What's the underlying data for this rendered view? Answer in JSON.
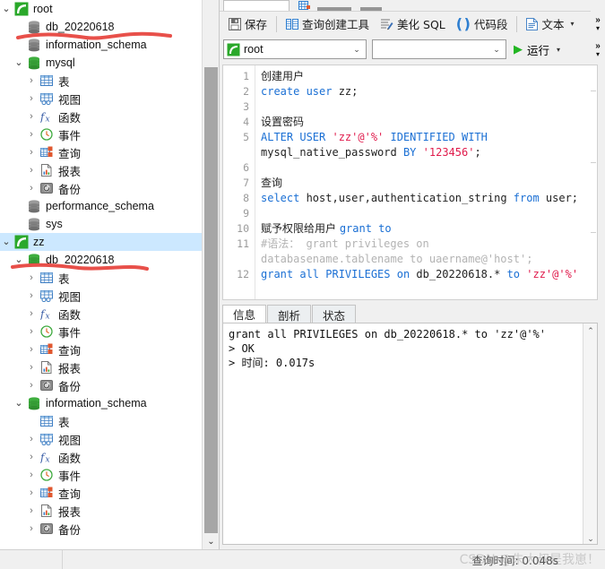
{
  "sidebar": {
    "nodes": [
      {
        "depth": 0,
        "twisty": "open",
        "icon": "connection-icon",
        "label": "root",
        "selected": false
      },
      {
        "depth": 1,
        "twisty": "none",
        "icon": "database-gray-icon",
        "label": "db_20220618",
        "selected": false
      },
      {
        "depth": 1,
        "twisty": "none",
        "icon": "database-gray-icon",
        "label": "information_schema",
        "selected": false
      },
      {
        "depth": 1,
        "twisty": "open",
        "icon": "database-green-icon",
        "label": "mysql",
        "selected": false
      },
      {
        "depth": 2,
        "twisty": "closed",
        "icon": "table-icon",
        "label": "表",
        "selected": false
      },
      {
        "depth": 2,
        "twisty": "closed",
        "icon": "view-icon",
        "label": "视图",
        "selected": false
      },
      {
        "depth": 2,
        "twisty": "closed",
        "icon": "function-icon",
        "label": "函数",
        "selected": false
      },
      {
        "depth": 2,
        "twisty": "closed",
        "icon": "event-icon",
        "label": "事件",
        "selected": false
      },
      {
        "depth": 2,
        "twisty": "closed",
        "icon": "query-icon",
        "label": "查询",
        "selected": false
      },
      {
        "depth": 2,
        "twisty": "closed",
        "icon": "report-icon",
        "label": "报表",
        "selected": false
      },
      {
        "depth": 2,
        "twisty": "closed",
        "icon": "backup-icon",
        "label": "备份",
        "selected": false
      },
      {
        "depth": 1,
        "twisty": "none",
        "icon": "database-gray-icon",
        "label": "performance_schema",
        "selected": false
      },
      {
        "depth": 1,
        "twisty": "none",
        "icon": "database-gray-icon",
        "label": "sys",
        "selected": false
      },
      {
        "depth": 0,
        "twisty": "open",
        "icon": "connection-icon",
        "label": "zz",
        "selected": true
      },
      {
        "depth": 1,
        "twisty": "open",
        "icon": "database-green-icon",
        "label": "db_20220618",
        "selected": false
      },
      {
        "depth": 2,
        "twisty": "closed",
        "icon": "table-icon",
        "label": "表",
        "selected": false
      },
      {
        "depth": 2,
        "twisty": "closed",
        "icon": "view-icon",
        "label": "视图",
        "selected": false
      },
      {
        "depth": 2,
        "twisty": "closed",
        "icon": "function-icon",
        "label": "函数",
        "selected": false
      },
      {
        "depth": 2,
        "twisty": "closed",
        "icon": "event-icon",
        "label": "事件",
        "selected": false
      },
      {
        "depth": 2,
        "twisty": "closed",
        "icon": "query-icon",
        "label": "查询",
        "selected": false
      },
      {
        "depth": 2,
        "twisty": "closed",
        "icon": "report-icon",
        "label": "报表",
        "selected": false
      },
      {
        "depth": 2,
        "twisty": "closed",
        "icon": "backup-icon",
        "label": "备份",
        "selected": false
      },
      {
        "depth": 1,
        "twisty": "open",
        "icon": "database-green-icon",
        "label": "information_schema",
        "selected": false
      },
      {
        "depth": 2,
        "twisty": "none",
        "icon": "table-icon",
        "label": "表",
        "selected": false
      },
      {
        "depth": 2,
        "twisty": "closed",
        "icon": "view-icon",
        "label": "视图",
        "selected": false
      },
      {
        "depth": 2,
        "twisty": "closed",
        "icon": "function-icon",
        "label": "函数",
        "selected": false
      },
      {
        "depth": 2,
        "twisty": "closed",
        "icon": "event-icon",
        "label": "事件",
        "selected": false
      },
      {
        "depth": 2,
        "twisty": "closed",
        "icon": "query-icon",
        "label": "查询",
        "selected": false
      },
      {
        "depth": 2,
        "twisty": "closed",
        "icon": "report-icon",
        "label": "报表",
        "selected": false
      },
      {
        "depth": 2,
        "twisty": "closed",
        "icon": "backup-icon",
        "label": "备份",
        "selected": false
      }
    ],
    "scroll_down_glyph": "⌄"
  },
  "annotations": {
    "color": "#e8504a",
    "marks": [
      {
        "name": "underline-db-20220618-root"
      },
      {
        "name": "underline-db-20220618-zz"
      }
    ]
  },
  "toolbar": {
    "save_label": "保存",
    "save_icon": "save-icon",
    "query_builder_label": "查询创建工具",
    "query_builder_icon": "query-builder-icon",
    "beautify_label": "美化 SQL",
    "beautify_icon": "beautify-icon",
    "snippet_label": "代码段",
    "snippet_icon": "parens-icon",
    "text_label": "文本",
    "text_icon": "text-icon",
    "overflow_glyph": "»",
    "caret_glyph": "▾"
  },
  "connbar": {
    "connection_value": "root",
    "connection_icon": "connection-icon",
    "database_value": "",
    "database_placeholder": "",
    "run_label": "运行",
    "run_icon": "play-icon",
    "dropdown_glyph": "⌄"
  },
  "editor": {
    "line_numbers": [
      "1",
      "2",
      "3",
      "4",
      "5",
      "6",
      "7",
      "8",
      "9",
      "10",
      "11",
      "12"
    ],
    "lines": [
      {
        "num": "1",
        "tokens": [
          {
            "t": "创建用户",
            "c": "cjk-code"
          }
        ]
      },
      {
        "num": "2",
        "tokens": [
          {
            "t": "create user",
            "c": "kw"
          },
          {
            "t": " zz;",
            "c": "plain"
          }
        ]
      },
      {
        "num": "3",
        "tokens": []
      },
      {
        "num": "4",
        "tokens": [
          {
            "t": "设置密码",
            "c": "cjk-code"
          }
        ]
      },
      {
        "num": "5",
        "tokens": [
          {
            "t": "ALTER USER ",
            "c": "kw"
          },
          {
            "t": "'zz'@'%'",
            "c": "str"
          },
          {
            "t": " IDENTIFIED WITH",
            "c": "kw"
          }
        ]
      },
      {
        "num": "",
        "tokens": [
          {
            "t": "mysql_native_password ",
            "c": "plain"
          },
          {
            "t": "BY ",
            "c": "kw"
          },
          {
            "t": "'123456'",
            "c": "str"
          },
          {
            "t": ";",
            "c": "plain"
          }
        ]
      },
      {
        "num": "6",
        "tokens": []
      },
      {
        "num": "7",
        "tokens": [
          {
            "t": "查询",
            "c": "cjk-code"
          }
        ]
      },
      {
        "num": "8",
        "tokens": [
          {
            "t": "select ",
            "c": "kw"
          },
          {
            "t": "host,user,authentication_string ",
            "c": "plain"
          },
          {
            "t": "from ",
            "c": "kw"
          },
          {
            "t": "user;",
            "c": "plain"
          }
        ]
      },
      {
        "num": "9",
        "tokens": []
      },
      {
        "num": "10",
        "tokens": [
          {
            "t": "赋予权限给用户 ",
            "c": "cjk-code"
          },
          {
            "t": "grant to",
            "c": "kw"
          }
        ]
      },
      {
        "num": "11",
        "tokens": [
          {
            "t": "#语法： grant privileges on",
            "c": "cmt"
          }
        ]
      },
      {
        "num": "",
        "tokens": [
          {
            "t": "databasename.tablename to uaername@'host';",
            "c": "cmt"
          }
        ]
      },
      {
        "num": "12",
        "tokens": [
          {
            "t": "grant all PRIVILEGES ",
            "c": "kw"
          },
          {
            "t": "on ",
            "c": "kw"
          },
          {
            "t": "db_20220618.* ",
            "c": "plain"
          },
          {
            "t": "to ",
            "c": "kw"
          },
          {
            "t": "'zz'@'%'",
            "c": "str"
          }
        ]
      }
    ]
  },
  "results": {
    "tabs": [
      {
        "label": "信息",
        "active": true
      },
      {
        "label": "剖析",
        "active": false
      },
      {
        "label": "状态",
        "active": false
      }
    ],
    "output": "grant all PRIVILEGES on db_20220618.* to 'zz'@'%'\n> OK\n> 时间: 0.017s",
    "scroll_up_glyph": "⌃",
    "scroll_down_glyph": "⌄"
  },
  "status": {
    "query_time": "查询时间: 0.048s",
    "watermark": "CSDN @朱大叔是我崽！"
  }
}
